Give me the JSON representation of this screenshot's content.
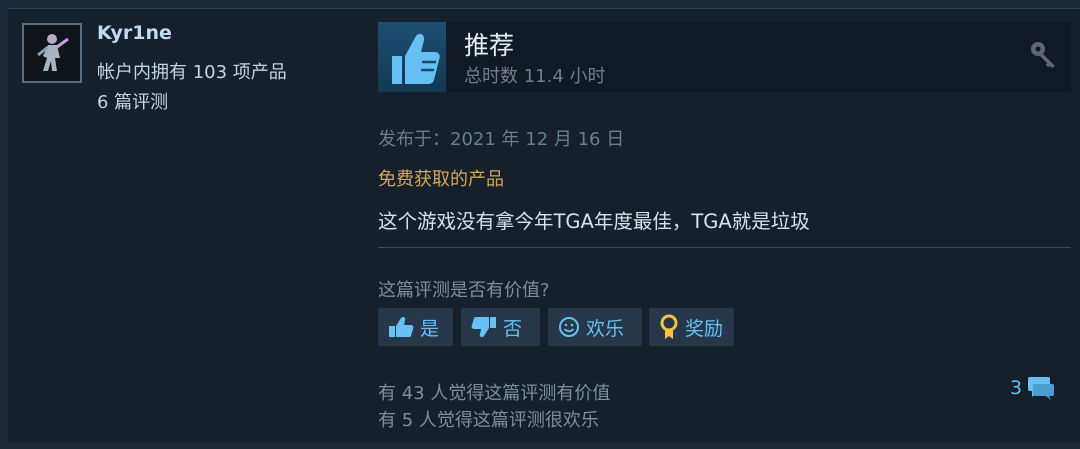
{
  "reviewer": {
    "name": "Kyr1ne",
    "products_owned": "帐户内拥有 103 项产品",
    "review_count": "6 篇评测"
  },
  "review": {
    "verdict": "推荐",
    "playtime": "总时数 11.4 小时",
    "posted_date": "发布于：2021 年 12 月 16 日",
    "acquisition": "免费获取的产品",
    "text": "这个游戏没有拿今年TGA年度最佳，TGA就是垃圾"
  },
  "feedback": {
    "question": "这篇评测是否有价值?",
    "yes_label": "是",
    "no_label": "否",
    "funny_label": "欢乐",
    "award_label": "奖励"
  },
  "stats": {
    "helpful": "有 43 人觉得这篇评测有价值",
    "funny": "有 5 人觉得这篇评测很欢乐",
    "comment_count": "3"
  },
  "icons": {
    "recommend": "thumbs-up-icon",
    "key": "key-icon",
    "comment": "speech-bubble-icon",
    "award": "award-ribbon-icon"
  },
  "colors": {
    "background": "#1b2838",
    "card": "#16202d",
    "link": "#67c1f5",
    "free_label": "#d2a65a"
  }
}
